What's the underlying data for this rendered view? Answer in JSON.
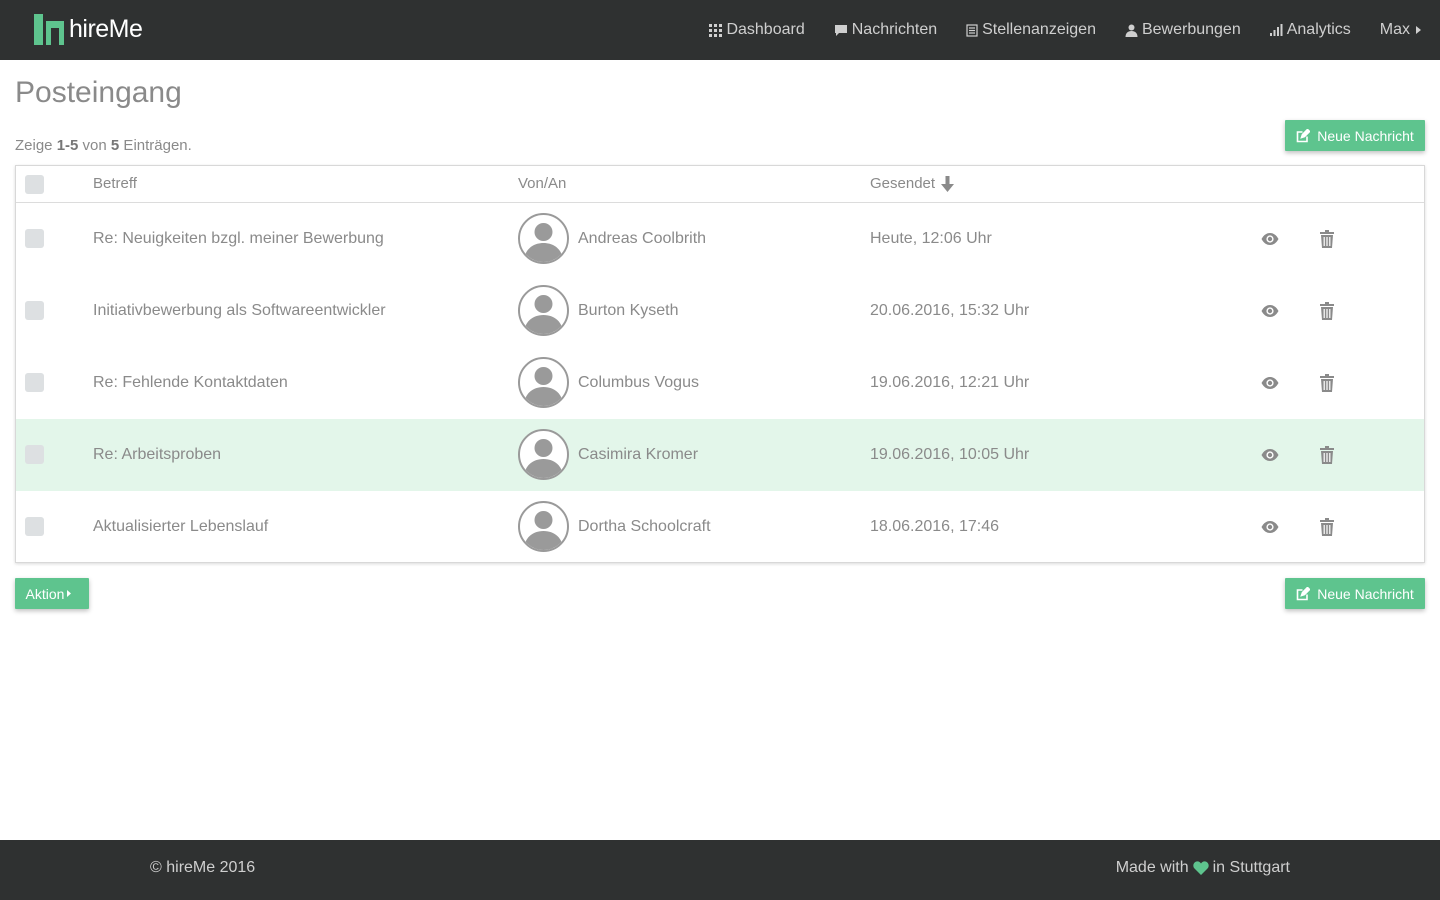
{
  "app": {
    "name": "hireMe"
  },
  "nav": {
    "dashboard": "Dashboard",
    "messages": "Nachrichten",
    "jobs": "Stellenanzeigen",
    "applications": "Bewerbungen",
    "analytics": "Analytics",
    "user": "Max"
  },
  "page": {
    "title": "Posteingang",
    "summary_prefix": "Zeige ",
    "summary_range": "1-5",
    "summary_mid": " von ",
    "summary_total": "5",
    "summary_suffix": " Einträgen."
  },
  "buttons": {
    "new_message": "Neue Nachricht",
    "action": "Aktion"
  },
  "table": {
    "columns": {
      "subject": "Betreff",
      "from_to": "Von/An",
      "sent": "Gesendet"
    },
    "rows": [
      {
        "subject": "Re: Neuigkeiten bzgl. meiner Bewerbung",
        "contact": "Andreas Coolbrith",
        "sent": "Heute, 12:06 Uhr",
        "highlighted": false
      },
      {
        "subject": "Initiativbewerbung als Softwareentwickler",
        "contact": "Burton Kyseth",
        "sent": "20.06.2016, 15:32 Uhr",
        "highlighted": false
      },
      {
        "subject": "Re: Fehlende Kontaktdaten",
        "contact": "Columbus Vogus",
        "sent": "19.06.2016, 12:21 Uhr",
        "highlighted": false
      },
      {
        "subject": "Re: Arbeitsproben",
        "contact": "Casimira Kromer",
        "sent": "19.06.2016, 10:05 Uhr",
        "highlighted": true
      },
      {
        "subject": "Aktualisierter Lebenslauf",
        "contact": "Dortha Schoolcraft",
        "sent": "18.06.2016, 17:46",
        "highlighted": false
      }
    ]
  },
  "footer": {
    "copyright": "© hireMe 2016",
    "made_with": "Made with",
    "location": "in Stuttgart"
  },
  "colors": {
    "accent": "#5ec48e",
    "navbar": "#2f3131",
    "row_highlight": "#e3f6ea"
  },
  "icons": {
    "dashboard": "grid-icon",
    "messages": "speech-bubble-icon",
    "jobs": "document-list-icon",
    "applications": "user-icon",
    "analytics": "bar-chart-icon",
    "view": "eye-icon",
    "delete": "trash-icon",
    "new_message": "edit-icon",
    "love": "heart-icon"
  }
}
